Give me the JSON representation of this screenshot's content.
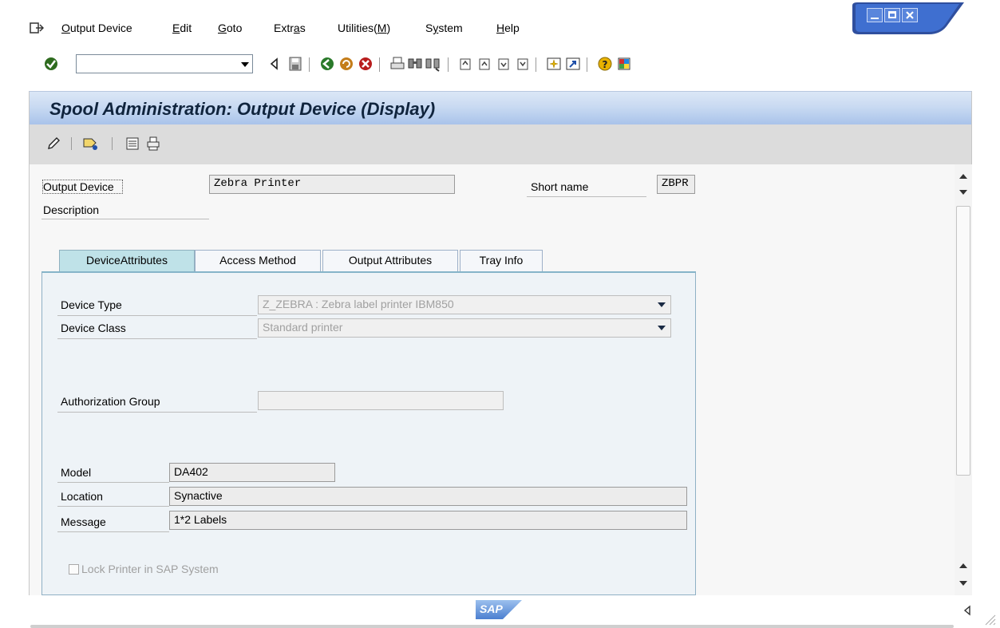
{
  "menubar": {
    "items": [
      {
        "label": "Output Device",
        "underline": "O"
      },
      {
        "label": "Edit",
        "underline": "E"
      },
      {
        "label": "Goto",
        "underline": "G"
      },
      {
        "label": "Extras",
        "underline": "a"
      },
      {
        "label": "Utilities(M)",
        "underline": "M"
      },
      {
        "label": "System",
        "underline": "y"
      },
      {
        "label": "Help",
        "underline": "H"
      }
    ]
  },
  "toolbar": {
    "command_field_value": ""
  },
  "title": "Spool Administration: Output Device (Display)",
  "header_fields": {
    "output_device_label": "Output Device",
    "output_device_value": "Zebra Printer",
    "short_name_label": "Short name",
    "short_name_value": "ZBPR",
    "description_label": "Description"
  },
  "tabs": [
    {
      "label": "DeviceAttributes",
      "active": true
    },
    {
      "label": "Access Method",
      "active": false
    },
    {
      "label": "Output Attributes",
      "active": false
    },
    {
      "label": "Tray Info",
      "active": false
    }
  ],
  "device_attributes": {
    "device_type_label": "Device Type",
    "device_type_value": "Z_ZEBRA  : Zebra label printer IBM850",
    "device_class_label": "Device Class",
    "device_class_value": "Standard printer",
    "auth_group_label": "Authorization Group",
    "auth_group_value": "",
    "model_label": "Model",
    "model_value": "DA402",
    "location_label": "Location",
    "location_value": "Synactive",
    "message_label": "Message",
    "message_value": "1*2 Labels",
    "lock_printer_label": "Lock Printer in SAP System",
    "lock_printer_checked": false
  },
  "statusbar": {
    "logo": "SAP"
  },
  "colors": {
    "title_gradient_top": "#dbe7f6",
    "title_gradient_bottom": "#a9c3ea",
    "app_toolbar_bg": "#dcdcdc",
    "active_tab_bg": "#bfe2e8",
    "window_control_blue": "#3a5fbf"
  }
}
